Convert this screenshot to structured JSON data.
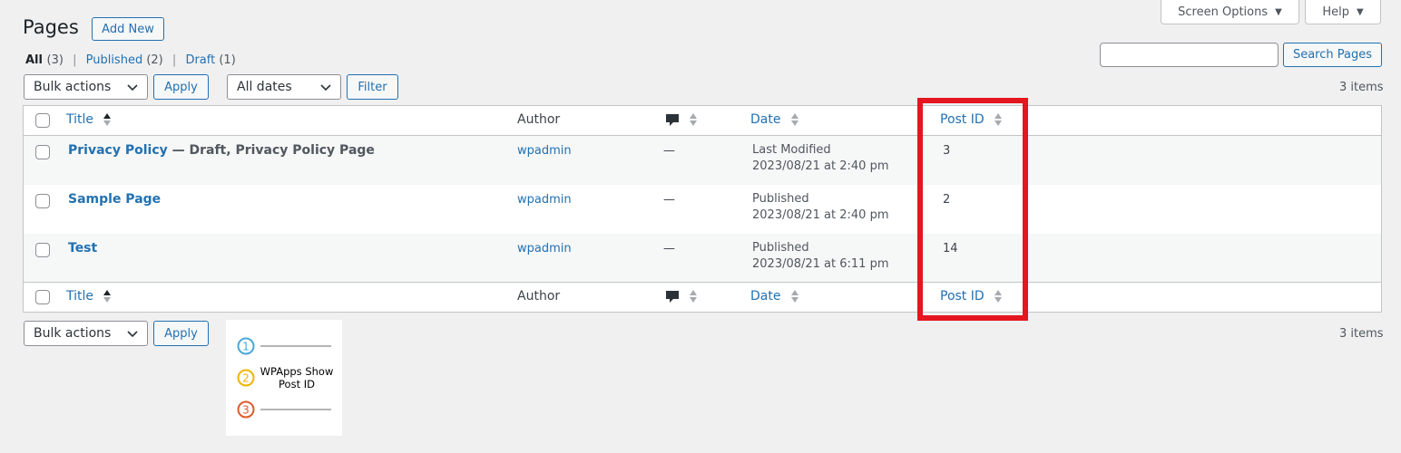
{
  "header": {
    "screen_options_label": "Screen Options",
    "help_label": "Help",
    "page_title": "Pages",
    "add_new_label": "Add New"
  },
  "views": [
    {
      "label": "All",
      "count": "(3)"
    },
    {
      "label": "Published",
      "count": "(2)"
    },
    {
      "label": "Draft",
      "count": "(1)"
    }
  ],
  "search": {
    "button_label": "Search Pages",
    "value": ""
  },
  "tablenav_top": {
    "bulk_actions_label": "Bulk actions",
    "apply_label": "Apply",
    "dates_label": "All dates",
    "filter_label": "Filter",
    "items_count": "3 items"
  },
  "columns": {
    "title": "Title",
    "author": "Author",
    "date": "Date",
    "post_id": "Post ID"
  },
  "rows": [
    {
      "title": "Privacy Policy",
      "state": " — Draft, Privacy Policy Page",
      "author": "wpadmin",
      "comments": "—",
      "date_status": "Last Modified",
      "date_value": "2023/08/21 at 2:40 pm",
      "post_id": "3"
    },
    {
      "title": "Sample Page",
      "state": "",
      "author": "wpadmin",
      "comments": "—",
      "date_status": "Published",
      "date_value": "2023/08/21 at 2:40 pm",
      "post_id": "2"
    },
    {
      "title": "Test",
      "state": "",
      "author": "wpadmin",
      "comments": "—",
      "date_status": "Published",
      "date_value": "2023/08/21 at 6:11 pm",
      "post_id": "14"
    }
  ],
  "tablenav_bottom": {
    "bulk_actions_label": "Bulk actions",
    "apply_label": "Apply",
    "items_count": "3 items"
  },
  "banner": {
    "text": "WPApps Show Post ID",
    "steps": [
      "1",
      "2",
      "3"
    ],
    "step_colors": [
      "#4aa8d8",
      "#f0b400",
      "#e05a2b"
    ]
  },
  "colors": {
    "accent": "#2271b1",
    "highlight": "#e4161f"
  }
}
